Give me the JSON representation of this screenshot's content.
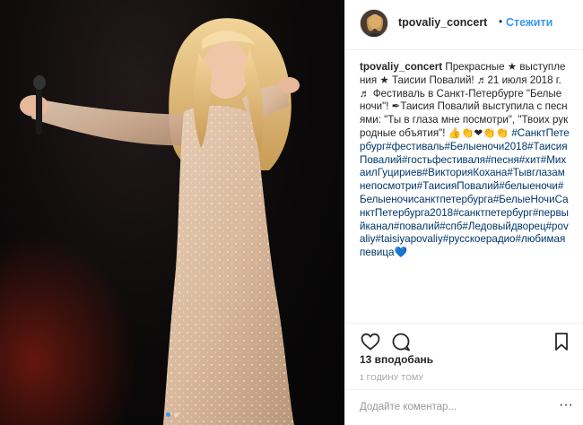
{
  "post": {
    "username": "tpovaliy_concert",
    "separator": "•",
    "follow_label": "Стежити",
    "caption": {
      "username": "tpovaliy_concert",
      "text": "Прекрасные ★ выступления ★ Таисии Повалий! ♬21 июля 2018 г. ♬ Фестиваль в Санкт-Петербурге \"Белые ночи\"! ✒Таисия Повалий выступила с песнями: \"Ты в глаза мне посмотри\", \"Твоих рук родные объятия\"! 👍👏❤👏👏",
      "hashtags": "#СанктПетербург#фестиваль#Белыеночи2018#ТаисияПовалий#гостьфестиваля#песня#хит#МихаилГуцириев#ВикторияКохана#Тывглазамнепосмотри#ТаисияПовалий#белыеночи#Белыеночисанктпетербурга#БелыеНочиСанктПетербурга2018#санктпетербург#первыйканал#повалий#спб#Ледовыйдворец#povaliy#taisiyapovaliy#русскоерадио#любимаяпевица",
      "end_emoji": "💙"
    },
    "likes_text": "13 вподобань",
    "time_ago": "1 годину тому",
    "comment_placeholder": "Додайте коментар...",
    "more_label": "···",
    "accent_color": "#3897f0",
    "hashtag_color": "#003569"
  },
  "icons": {
    "like": "heart-icon",
    "comment": "comment-icon",
    "save": "bookmark-icon",
    "more": "more-icon"
  }
}
